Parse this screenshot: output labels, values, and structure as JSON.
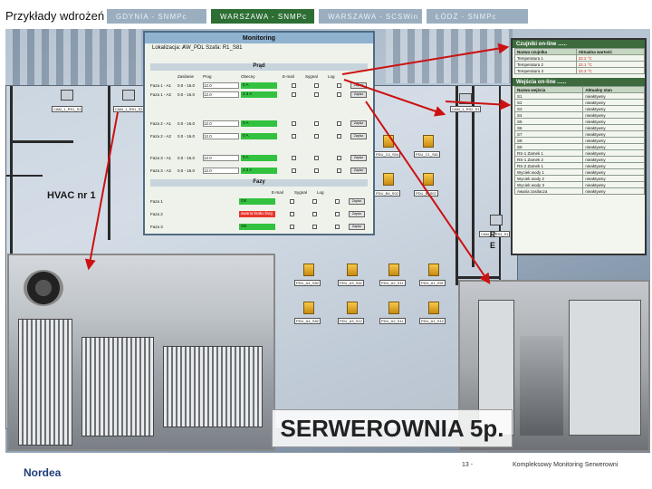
{
  "title": "Przykłady wdrożeń",
  "tabs": [
    {
      "label": "GDYNIA - SNMPc"
    },
    {
      "label": "WARSZAWA - SNMPc"
    },
    {
      "label": "WARSZAWA - SCSWin"
    },
    {
      "label": "ŁÓDŹ - SNMPc"
    }
  ],
  "monitoring": {
    "title": "Monitoring",
    "info": "Lokalizacja: ȺW_PDL  Szafa: R1_S81",
    "section_prad": "Prąd",
    "headers": [
      "Zasilanie",
      "Prog",
      "Obecny",
      "E-mail",
      "Sygnal",
      "Log"
    ],
    "rows": [
      {
        "name": "Faza 1 - A1",
        "range": "0.0 - 16.0",
        "value": "12.0",
        "status": "0 A",
        "state": "ok",
        "button": "Zapisz"
      },
      {
        "name": "Faza 1 - A2",
        "range": "0.0 - 16.0",
        "value": "12.0",
        "status": "2.3 A",
        "state": "ok",
        "button": "Zapisz"
      },
      {
        "name": "Faza 2 - A1",
        "range": "0.0 - 16.0",
        "value": "12.0",
        "status": "0 A",
        "state": "ok",
        "button": "Zapisz"
      },
      {
        "name": "Faza 2 - A2",
        "range": "0.0 - 16.0",
        "value": "12.0",
        "status": "0 A",
        "state": "ok",
        "button": "Zapisz"
      },
      {
        "name": "Faza 3 - A1",
        "range": "0.0 - 16.0",
        "value": "12.0",
        "status": "0 A",
        "state": "ok",
        "button": "Zapisz"
      },
      {
        "name": "Faza 3 - A2",
        "range": "0.0 - 16.0",
        "value": "12.0",
        "status": "2.3 A",
        "state": "ok",
        "button": "Zapisz"
      }
    ],
    "section_fazy": "Fazy",
    "fazy_headers": [
      "E-mail",
      "Sygnał",
      "Log"
    ],
    "fazy_rows": [
      {
        "name": "Faza 1",
        "status": "OK",
        "state": "ok",
        "button": "Zapisz"
      },
      {
        "name": "Faza 2",
        "status": "awaria braku fazy",
        "state": "err",
        "button": "Zapisz"
      },
      {
        "name": "Faza 3",
        "status": "OK",
        "state": "ok",
        "button": "Zapisz"
      }
    ]
  },
  "czujniki": {
    "title": "Czujniki on-line ......",
    "headers": [
      "Nazwa czujnika",
      "Aktualna wartość"
    ],
    "rows": [
      {
        "name": "Temperatura 1",
        "value": "22.2 °C"
      },
      {
        "name": "Temperatura 2",
        "value": "22.1 °C"
      },
      {
        "name": "Temperatura 3",
        "value": "22.3 °C"
      }
    ]
  },
  "wejscia": {
    "title": "Wejścia on-line ......",
    "headers": [
      "Nazwa wejścia",
      "Aktualny stan"
    ],
    "rows": [
      {
        "name": "S1",
        "value": "nieaktywny"
      },
      {
        "name": "S2",
        "value": "nieaktywny"
      },
      {
        "name": "S3",
        "value": "nieaktywny"
      },
      {
        "name": "S4",
        "value": "nieaktywny"
      },
      {
        "name": "S5",
        "value": "nieaktywny"
      },
      {
        "name": "S6",
        "value": "nieaktywny"
      },
      {
        "name": "S7",
        "value": "nieaktywny"
      },
      {
        "name": "S8",
        "value": "nieaktywny"
      },
      {
        "name": "S9",
        "value": "nieaktywny"
      },
      {
        "name": "RS-1 Zamek 1",
        "value": "nieaktywny"
      },
      {
        "name": "RS-1 Zamek 2",
        "value": "nieaktywny"
      },
      {
        "name": "RS-2 Zamek 1",
        "value": "nieaktywny"
      },
      {
        "name": "Wyciek wody 1",
        "value": "nieaktywny"
      },
      {
        "name": "Wyciek wody 2",
        "value": "nieaktywny"
      },
      {
        "name": "Wyciek wody 3",
        "value": "nieaktywny"
      },
      {
        "name": "Awaria zasilacza",
        "value": "nieaktywny"
      }
    ]
  },
  "floorplan": {
    "hvac": "HVAC nr 1",
    "re": "R E",
    "cameras": [
      "CAM_1_RS1_S1",
      "CAM_1_RS1_S2",
      "CAM_1_RS2_S1",
      "CAM_1_RS3_S1"
    ],
    "pdus": [
      "PDU_C4_S04",
      "PDU_C1_S81",
      "PDU_B4_S02",
      "PDU_B_S02",
      "PDU_A4_S80",
      "PDU_A3_S62",
      "PDU_A2_S11",
      "PDU_A1_S51",
      "PDU_A4_S82",
      "PDU_A3_S12",
      "PDU_A2_S11",
      "PDU_A1_S12"
    ]
  },
  "room_label": "SERWEROWNIA 5p.",
  "footer": {
    "logo": "Nordea",
    "page": "13 -",
    "note": "Kompleksowy Monitoring Serwerowni"
  },
  "colors": {
    "accent_tab": "#2d6e34",
    "inactive_tab": "#9aaebf",
    "ok": "#33c23f",
    "err": "#e8362c",
    "arrow": "#cc1111"
  }
}
